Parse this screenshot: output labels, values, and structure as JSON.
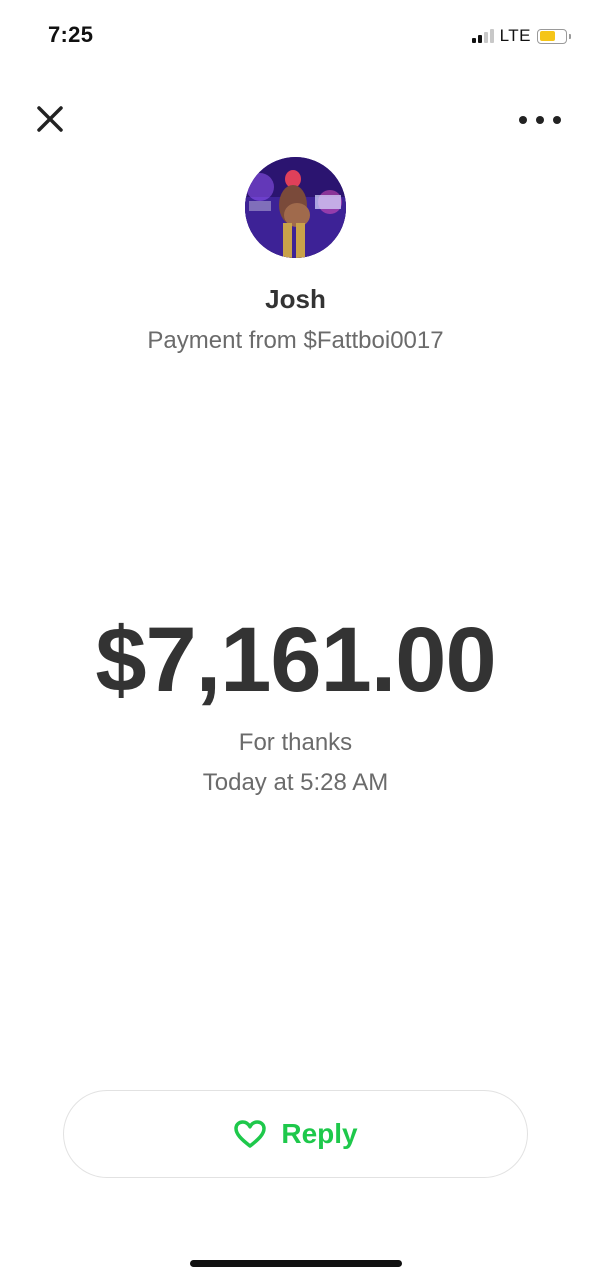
{
  "status_bar": {
    "time": "7:25",
    "network": "LTE",
    "battery_level": 0.6,
    "battery_color": "#f5c518"
  },
  "nav": {
    "close_icon": "close-icon",
    "more_icon": "more-horizontal-icon"
  },
  "sender": {
    "name": "Josh",
    "subtitle": "Payment from $Fattboi0017"
  },
  "payment": {
    "amount": "$7,161.00",
    "note": "For thanks",
    "date": "Today at 5:28 AM"
  },
  "actions": {
    "reply_label": "Reply",
    "reply_icon": "heart-outline-icon",
    "accent_color": "#1ec84b"
  }
}
